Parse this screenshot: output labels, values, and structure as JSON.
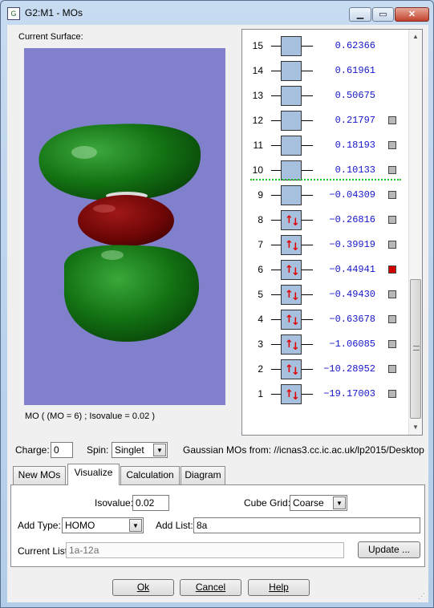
{
  "window": {
    "title": "G2:M1 - MOs",
    "app_icon": "gaussview-icon",
    "min_glyph": "▁",
    "max_glyph": "▭",
    "close_glyph": "✕"
  },
  "surface": {
    "label": "Current Surface:",
    "caption": "MO ( (MO = 6) ; Isovalue = 0.02 )",
    "background_color": "#8080cc",
    "positive_lobe_color": "#1a7a1a",
    "negative_lobe_color": "#8a0a0a"
  },
  "mo_list": {
    "rows": [
      {
        "num": "15",
        "energy": "0.62366",
        "occupied": false,
        "check": "none"
      },
      {
        "num": "14",
        "energy": "0.61961",
        "occupied": false,
        "check": "none"
      },
      {
        "num": "13",
        "energy": "0.50675",
        "occupied": false,
        "check": "none"
      },
      {
        "num": "12",
        "energy": "0.21797",
        "occupied": false,
        "check": "grey"
      },
      {
        "num": "11",
        "energy": "0.18193",
        "occupied": false,
        "check": "grey"
      },
      {
        "num": "10",
        "energy": "0.10133",
        "occupied": false,
        "check": "grey"
      },
      {
        "num": "9",
        "energy": "−0.04309",
        "occupied": false,
        "check": "grey"
      },
      {
        "num": "8",
        "energy": "−0.26816",
        "occupied": true,
        "check": "grey"
      },
      {
        "num": "7",
        "energy": "−0.39919",
        "occupied": true,
        "check": "grey"
      },
      {
        "num": "6",
        "energy": "−0.44941",
        "occupied": true,
        "check": "red"
      },
      {
        "num": "5",
        "energy": "−0.49430",
        "occupied": true,
        "check": "grey"
      },
      {
        "num": "4",
        "energy": "−0.63678",
        "occupied": true,
        "check": "grey"
      },
      {
        "num": "3",
        "energy": "−1.06085",
        "occupied": true,
        "check": "grey"
      },
      {
        "num": "2",
        "energy": "−10.28952",
        "occupied": true,
        "check": "grey"
      },
      {
        "num": "1",
        "energy": "−19.17003",
        "occupied": true,
        "check": "grey"
      }
    ],
    "spin_up_glyph": "↑",
    "spin_down_glyph": "↓",
    "homo_lumo_line_color": "#22c022",
    "selected_color": "#d00000",
    "energy_color": "#1515c8"
  },
  "info_row": {
    "charge_label": "Charge:",
    "charge_value": "0",
    "spin_label": "Spin:",
    "spin_value": "Singlet",
    "source_text": "Gaussian MOs from:  //icnas3.cc.ic.ac.uk/lp2015/Desktop"
  },
  "tabs": [
    {
      "label": "New MOs"
    },
    {
      "label": "Visualize"
    },
    {
      "label": "Calculation"
    },
    {
      "label": "Diagram"
    }
  ],
  "visualize": {
    "isovalue_label": "Isovalue:",
    "isovalue_value": "0.02",
    "cube_grid_label": "Cube Grid:",
    "cube_grid_value": "Coarse",
    "add_type_label": "Add Type:",
    "add_type_value": "HOMO",
    "add_list_label": "Add List:",
    "add_list_value": "8a",
    "current_list_label": "Current List:",
    "current_list_value": "1a-12a",
    "update_label": "Update ..."
  },
  "buttons": {
    "ok": "Ok",
    "cancel": "Cancel",
    "help": "Help"
  }
}
